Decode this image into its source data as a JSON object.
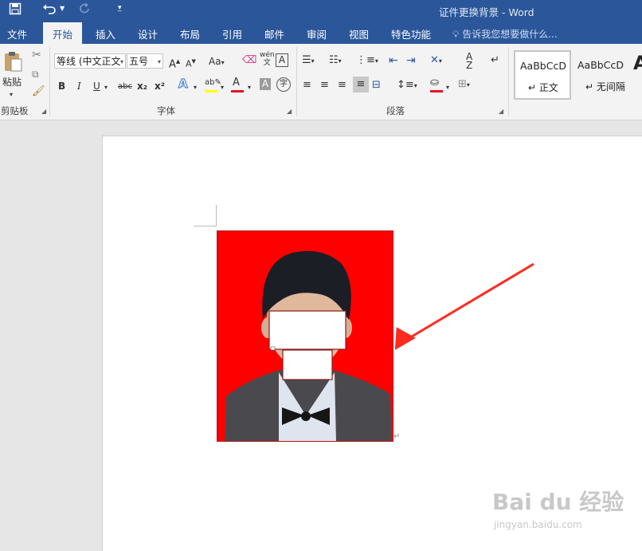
{
  "window": {
    "title": "证件更换背景 - Word"
  },
  "quick_access": {
    "save_icon": "save-icon",
    "undo_icon": "undo-icon",
    "redo_icon": "redo-icon",
    "customize_icon": "customize-icon"
  },
  "tabs": [
    {
      "label": "文件"
    },
    {
      "label": "开始"
    },
    {
      "label": "插入"
    },
    {
      "label": "设计"
    },
    {
      "label": "布局"
    },
    {
      "label": "引用"
    },
    {
      "label": "邮件"
    },
    {
      "label": "审阅"
    },
    {
      "label": "视图"
    },
    {
      "label": "特色功能"
    }
  ],
  "active_tab": "开始",
  "tell_me": {
    "placeholder": "告诉我您想要做什么..."
  },
  "clipboard": {
    "paste_label": "粘贴",
    "group_label": "剪贴板"
  },
  "font": {
    "name": "等线 (中文正文",
    "size": "五号",
    "group_label": "字体",
    "change_case": "Aa",
    "phonetic_top": "wén",
    "phonetic_bottom": "文",
    "bold": "B",
    "italic": "I",
    "underline": "U",
    "strike": "abc",
    "subscript": "x₂",
    "superscript": "x²",
    "font_color_label": "A",
    "highlight_color": "#ffff00",
    "font_color": "#e81123"
  },
  "paragraph": {
    "group_label": "段落",
    "shading_color": "#e81123"
  },
  "styles": [
    {
      "sample": "AaBbCcD",
      "name": "正文"
    },
    {
      "sample": "AaBbCcD",
      "name": "无间隔"
    },
    {
      "sample": "A",
      "name": ""
    }
  ],
  "document": {
    "paragraph_mark": "↵",
    "background_color": "#ff0000",
    "arrow_color": "#ff2a1f"
  },
  "watermark": {
    "brand": "Bai du 经验",
    "url": "jingyan.baidu.com"
  }
}
